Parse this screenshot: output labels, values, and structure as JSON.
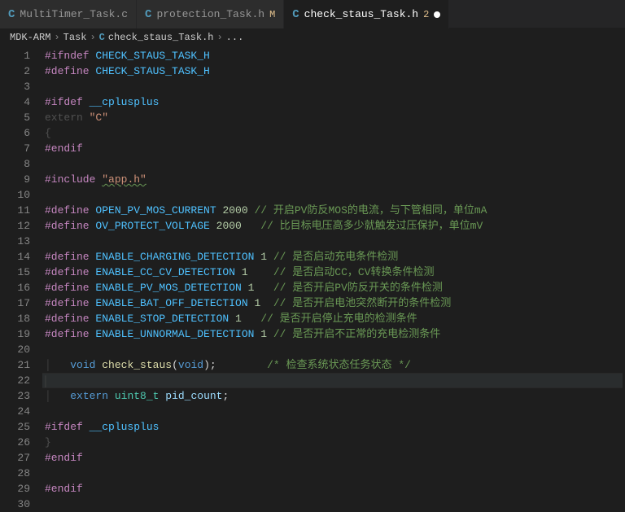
{
  "tabs": [
    {
      "icon": "C",
      "label": "MultiTimer_Task.c",
      "badge": "",
      "numBadge": "",
      "active": false,
      "dirty": false
    },
    {
      "icon": "C",
      "label": "protection_Task.h",
      "badge": "M",
      "numBadge": "",
      "active": false,
      "dirty": false
    },
    {
      "icon": "C",
      "label": "check_staus_Task.h",
      "badge": "",
      "numBadge": "2",
      "active": true,
      "dirty": true
    }
  ],
  "breadcrumb": {
    "parts": [
      "MDK-ARM",
      "Task"
    ],
    "icon": "C",
    "file": "check_staus_Task.h",
    "trail": "..."
  },
  "code": {
    "lines": [
      {
        "n": 1,
        "seg": [
          [
            "k-pre",
            "#ifndef"
          ],
          [
            "",
            ""
          ],
          [
            "macro",
            " CHECK_STAUS_TASK_H"
          ]
        ]
      },
      {
        "n": 2,
        "seg": [
          [
            "k-pre",
            "#define"
          ],
          [
            "macro",
            " CHECK_STAUS_TASK_H"
          ]
        ]
      },
      {
        "n": 3,
        "seg": []
      },
      {
        "n": 4,
        "seg": [
          [
            "k-pre",
            "#ifdef"
          ],
          [
            "macro",
            " __cplusplus"
          ]
        ]
      },
      {
        "n": 5,
        "seg": [
          [
            "ext",
            "extern "
          ],
          [
            "str",
            "\"C\""
          ]
        ]
      },
      {
        "n": 6,
        "seg": [
          [
            "ext",
            "{"
          ]
        ]
      },
      {
        "n": 7,
        "seg": [
          [
            "k-pre",
            "#endif"
          ]
        ]
      },
      {
        "n": 8,
        "seg": []
      },
      {
        "n": 9,
        "seg": [
          [
            "k-pre",
            "#include"
          ],
          [
            "",
            " "
          ],
          [
            "str inc-underline",
            "\"app.h\""
          ]
        ]
      },
      {
        "n": 10,
        "seg": []
      },
      {
        "n": 11,
        "seg": [
          [
            "k-pre",
            "#define"
          ],
          [
            "macro",
            " OPEN_PV_MOS_CURRENT"
          ],
          [
            "num",
            " 2000"
          ],
          [
            "",
            ""
          ],
          [
            "cmt",
            " // 开启PV防反MOS的电流，与下管相同，单位mA"
          ]
        ]
      },
      {
        "n": 12,
        "seg": [
          [
            "k-pre",
            "#define"
          ],
          [
            "macro",
            " OV_PROTECT_VOLTAGE"
          ],
          [
            "num",
            " 2000"
          ],
          [
            "",
            "   "
          ],
          [
            "cmt",
            "// 比目标电压高多少就触发过压保护，单位mV"
          ]
        ]
      },
      {
        "n": 13,
        "seg": []
      },
      {
        "n": 14,
        "seg": [
          [
            "k-pre",
            "#define"
          ],
          [
            "macro",
            " ENABLE_CHARGING_DETECTION"
          ],
          [
            "num",
            " 1"
          ],
          [
            "",
            ""
          ],
          [
            "cmt",
            " // 是否启动充电条件检测"
          ]
        ]
      },
      {
        "n": 15,
        "seg": [
          [
            "k-pre",
            "#define"
          ],
          [
            "macro",
            " ENABLE_CC_CV_DETECTION"
          ],
          [
            "num",
            " 1"
          ],
          [
            "",
            "    "
          ],
          [
            "cmt",
            "// 是否启动CC，CV转换条件检测"
          ]
        ]
      },
      {
        "n": 16,
        "seg": [
          [
            "k-pre",
            "#define"
          ],
          [
            "macro",
            " ENABLE_PV_MOS_DETECTION"
          ],
          [
            "num",
            " 1"
          ],
          [
            "",
            "   "
          ],
          [
            "cmt",
            "// 是否开启PV防反开关的条件检测"
          ]
        ]
      },
      {
        "n": 17,
        "seg": [
          [
            "k-pre",
            "#define"
          ],
          [
            "macro",
            " ENABLE_BAT_OFF_DETECTION"
          ],
          [
            "num",
            " 1"
          ],
          [
            "",
            "  "
          ],
          [
            "cmt",
            "// 是否开启电池突然断开的条件检测"
          ]
        ]
      },
      {
        "n": 18,
        "seg": [
          [
            "k-pre",
            "#define"
          ],
          [
            "macro",
            " ENABLE_STOP_DETECTION"
          ],
          [
            "num",
            " 1"
          ],
          [
            "",
            "   "
          ],
          [
            "cmt",
            "// 是否开启停止充电的检测条件"
          ]
        ]
      },
      {
        "n": 19,
        "seg": [
          [
            "k-pre",
            "#define"
          ],
          [
            "macro",
            " ENABLE_UNNORMAL_DETECTION"
          ],
          [
            "num",
            " 1"
          ],
          [
            "",
            ""
          ],
          [
            "cmt",
            " // 是否开启不正常的充电检测条件"
          ]
        ]
      },
      {
        "n": 20,
        "seg": []
      },
      {
        "n": 21,
        "seg": [
          [
            "ind",
            "│   "
          ],
          [
            "kw",
            "void"
          ],
          [
            "",
            " "
          ],
          [
            "fn",
            "check_staus"
          ],
          [
            "",
            "("
          ],
          [
            "kw",
            "void"
          ],
          [
            "",
            ");        "
          ],
          [
            "cmt",
            "/* 检查系统状态任务状态 */"
          ]
        ]
      },
      {
        "n": 22,
        "current": true,
        "seg": [
          [
            "ind",
            "│"
          ]
        ]
      },
      {
        "n": 23,
        "seg": [
          [
            "ind",
            "│   "
          ],
          [
            "kw",
            "extern"
          ],
          [
            "",
            " "
          ],
          [
            "type",
            "uint8_t"
          ],
          [
            "",
            " "
          ],
          [
            "var",
            "pid_count"
          ],
          [
            "",
            ";"
          ]
        ]
      },
      {
        "n": 24,
        "seg": []
      },
      {
        "n": 25,
        "seg": [
          [
            "k-pre",
            "#ifdef"
          ],
          [
            "macro",
            " __cplusplus"
          ]
        ]
      },
      {
        "n": 26,
        "seg": [
          [
            "ext",
            "}"
          ]
        ]
      },
      {
        "n": 27,
        "seg": [
          [
            "k-pre",
            "#endif"
          ]
        ]
      },
      {
        "n": 28,
        "seg": []
      },
      {
        "n": 29,
        "seg": [
          [
            "k-pre",
            "#endif"
          ]
        ]
      },
      {
        "n": 30,
        "seg": []
      }
    ]
  }
}
